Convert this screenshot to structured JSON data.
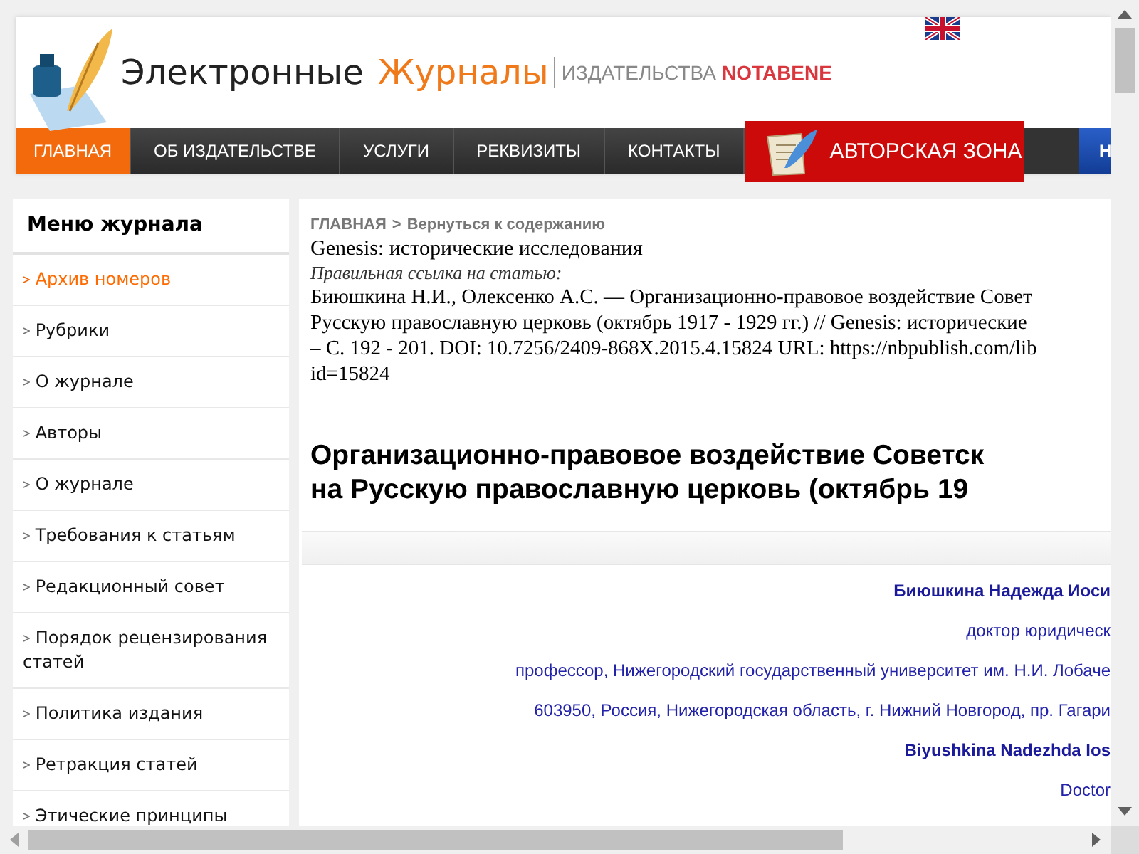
{
  "header": {
    "logo_title": "Электронные",
    "logo_accent": "Журналы",
    "publisher_prefix": "ИЗДАТЕЛЬСТВА",
    "publisher_name": "NOTABENE"
  },
  "nav": {
    "items": [
      {
        "label": "ГЛАВНАЯ",
        "selected": true
      },
      {
        "label": "ОБ ИЗДАТЕЛЬСТВЕ",
        "selected": false
      },
      {
        "label": "УСЛУГИ",
        "selected": false
      },
      {
        "label": "РЕКВИЗИТЫ",
        "selected": false
      },
      {
        "label": "КОНТАКТЫ",
        "selected": false
      }
    ],
    "author_zone": {
      "label": "АВТОРСКАЯ ЗОНА"
    },
    "extra": {
      "label": "Н"
    }
  },
  "sidebar": {
    "title": "Меню журнала",
    "items": [
      {
        "label": "Архив номеров",
        "selected": true
      },
      {
        "label": "Рубрики",
        "selected": false
      },
      {
        "label": "О журнале",
        "selected": false
      },
      {
        "label": "Авторы",
        "selected": false
      },
      {
        "label": "О журнале",
        "selected": false
      },
      {
        "label": "Требования к статьям",
        "selected": false
      },
      {
        "label": "Редакционный совет",
        "selected": false
      },
      {
        "label": "Порядок рецензирования статей",
        "selected": false
      },
      {
        "label": "Политика издания",
        "selected": false
      },
      {
        "label": "Ретракция статей",
        "selected": false
      },
      {
        "label": "Этические принципы",
        "selected": false
      }
    ]
  },
  "article": {
    "breadcrumb": {
      "home": "ГЛАВНАЯ",
      "separator": ">",
      "back": "Вернуться к содержанию"
    },
    "journal": "Genesis: исторические исследования",
    "citation_label": "Правильная ссылка на статью:",
    "citation_lines": [
      "Биюшкина Н.И., Олексенко А.С. — Организационно-правовое воздействие Совет",
      "Русскую православную церковь (октябрь 1917 - 1929 гг.) // Genesis: исторические",
      "– С. 192 - 201. DOI: 10.7256/2409-868X.2015.4.15824 URL: https://nbpublish.com/lib",
      "id=15824"
    ],
    "title_lines": [
      "Организационно-правовое воздействие Советск",
      "на Русскую православную церковь (октябрь 19"
    ],
    "authors": [
      {
        "text": "Биюшкина Надежда Иоси",
        "kind": "name"
      },
      {
        "text": "доктор юридическ",
        "kind": "info"
      },
      {
        "text": "профессор, Нижегородский государственный университет им. Н.И. Лобаче",
        "kind": "info"
      },
      {
        "text": "603950, Россия, Нижегородская область, г. Нижний Новгород, пр. Гагари",
        "kind": "info"
      },
      {
        "text": "Biyushkina Nadezhda Ios",
        "kind": "name"
      },
      {
        "text": "Doctor",
        "kind": "info"
      }
    ]
  }
}
